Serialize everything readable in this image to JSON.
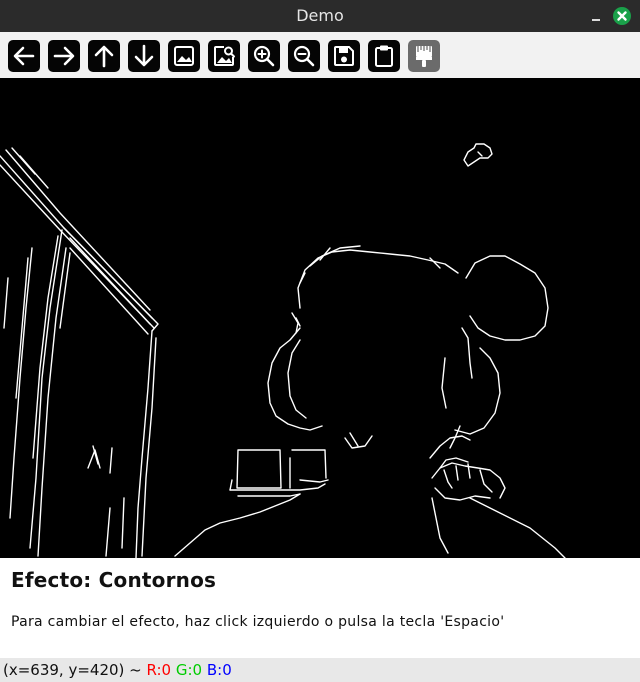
{
  "window": {
    "title": "Demo"
  },
  "toolbar": {
    "buttons": [
      {
        "icon": "arrow-left-icon"
      },
      {
        "icon": "arrow-right-icon"
      },
      {
        "icon": "arrow-up-icon"
      },
      {
        "icon": "arrow-down-icon"
      },
      {
        "icon": "image-icon"
      },
      {
        "icon": "image-search-icon"
      },
      {
        "icon": "zoom-in-icon"
      },
      {
        "icon": "zoom-out-icon"
      },
      {
        "icon": "save-icon"
      },
      {
        "icon": "clipboard-icon"
      },
      {
        "icon": "paint-brush-icon"
      }
    ]
  },
  "main": {
    "effect_title": "Efecto: Contornos",
    "instructions": "Para cambiar el efecto, haz click izquierdo o pulsa la tecla 'Espacio'"
  },
  "status": {
    "coords": "(x=639, y=420) ~",
    "r_label": "R:0",
    "g_label": "G:0",
    "b_label": "B:0",
    "r_color": "#ff0000",
    "g_color": "#00cc00",
    "b_color": "#0000ff"
  }
}
